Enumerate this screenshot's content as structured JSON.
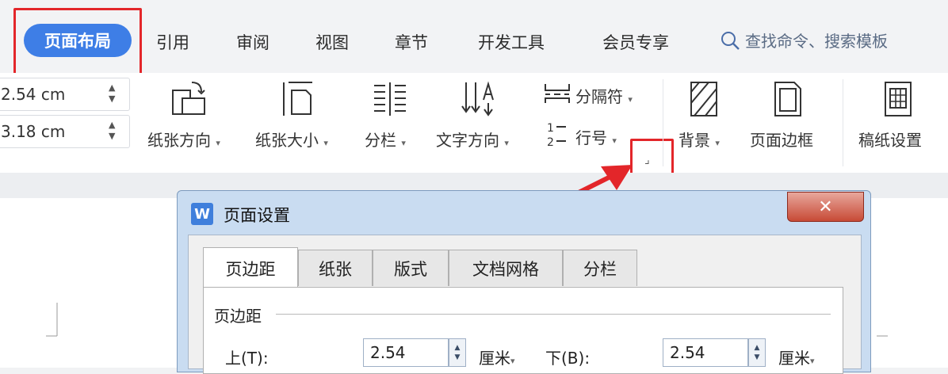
{
  "tabs": {
    "active": "页面布局",
    "items": [
      "引用",
      "审阅",
      "视图",
      "章节",
      "开发工具",
      "会员专享"
    ],
    "search_placeholder": "查找命令、搜索模板"
  },
  "ribbon": {
    "margin_top": "2.54 cm",
    "margin_left": "3.18 cm",
    "buttons": {
      "orientation": "纸张方向",
      "size": "纸张大小",
      "columns": "分栏",
      "text_direction": "文字方向",
      "breaks": "分隔符",
      "line_numbers": "行号",
      "background": "背景",
      "page_border": "页面边框",
      "manuscript": "稿纸设置"
    },
    "launcher_glyph": "⌟"
  },
  "dialog": {
    "title": "页面设置",
    "logo": "W",
    "close": "✕",
    "tabs": [
      "页边距",
      "纸张",
      "版式",
      "文档网格",
      "分栏"
    ],
    "section": "页边距",
    "top_label": "上(T):",
    "top_value": "2.54",
    "top_unit": "厘米",
    "bottom_label": "下(B):",
    "bottom_value": "2.54",
    "bottom_unit": "厘米"
  },
  "colors": {
    "accent": "#3e7ee6",
    "highlight": "#e3262a"
  }
}
